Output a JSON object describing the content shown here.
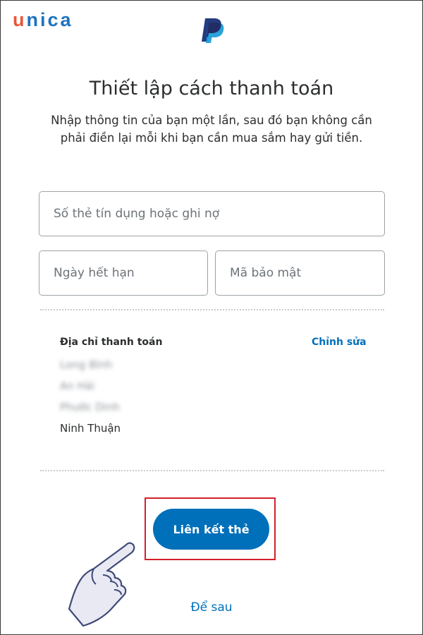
{
  "watermark": {
    "brand_first": "u",
    "brand_rest": "nica"
  },
  "logo": {
    "icon": "paypal-logo-icon"
  },
  "header": {
    "title": "Thiết lập cách thanh toán",
    "subtitle": "Nhập thông tin của bạn một lần, sau đó bạn không cần phải điền lại mỗi khi bạn cần mua sắm hay gửi tiền."
  },
  "form": {
    "card_number_placeholder": "Số thẻ tín dụng hoặc ghi nợ",
    "expiry_placeholder": "Ngày hết hạn",
    "security_code_placeholder": "Mã bảo mật"
  },
  "billing": {
    "label": "Địa chỉ thanh toán",
    "edit_label": "Chỉnh sửa",
    "lines": [
      "Long Bình",
      "An Hải",
      "Phước Dinh",
      "Ninh Thuận"
    ]
  },
  "actions": {
    "link_card_label": "Liên kết thẻ",
    "later_label": "Để sau"
  },
  "colors": {
    "accent": "#0070ba",
    "highlight_box": "#d4202a",
    "brand_orange": "#e8563a",
    "brand_blue": "#1e73be"
  },
  "pointer": {
    "icon": "pointing-hand-icon"
  }
}
